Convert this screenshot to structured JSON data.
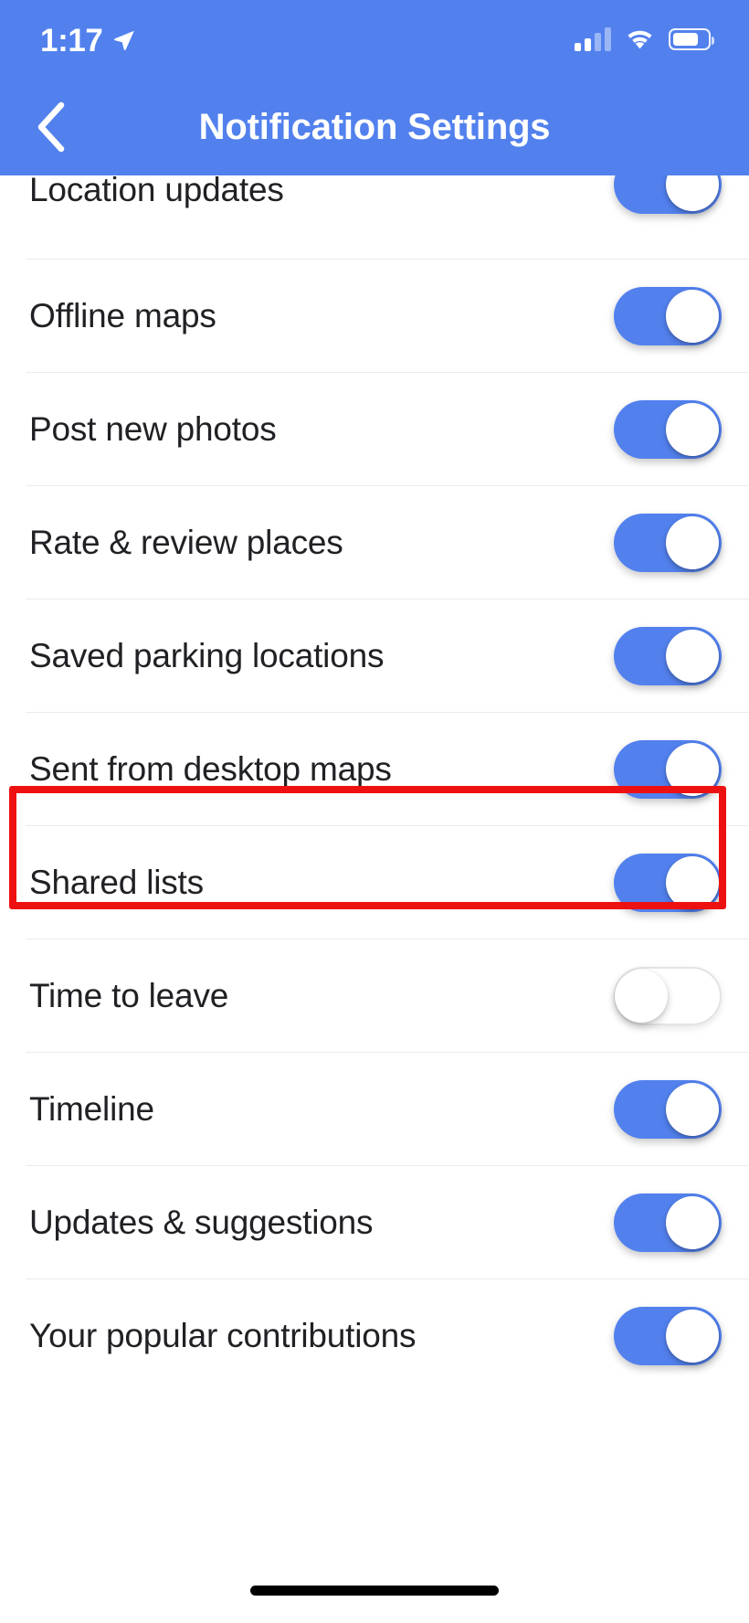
{
  "status_bar": {
    "time": "1:17",
    "location_arrow_icon": "location-arrow-icon",
    "cellular_icon": "cellular-signal-icon",
    "cellular_bars_filled": 2,
    "cellular_bars_total": 4,
    "wifi_icon": "wifi-icon",
    "battery_icon": "battery-icon",
    "battery_level_percent": 66
  },
  "header": {
    "back_icon": "chevron-left-icon",
    "title": "Notification Settings",
    "background_color": "#5281EE",
    "text_color": "#FFFFFF"
  },
  "settings_list": {
    "accent_color": "#5281EE",
    "rows": [
      {
        "label": "Location updates",
        "state": "on",
        "clipped": true
      },
      {
        "label": "Offline maps",
        "state": "on",
        "clipped": false
      },
      {
        "label": "Post new photos",
        "state": "on",
        "clipped": false
      },
      {
        "label": "Rate & review places",
        "state": "on",
        "clipped": false
      },
      {
        "label": "Saved parking locations",
        "state": "on",
        "clipped": false
      },
      {
        "label": "Sent from desktop maps",
        "state": "on",
        "clipped": false
      },
      {
        "label": "Shared lists",
        "state": "on",
        "clipped": false
      },
      {
        "label": "Time to leave",
        "state": "off",
        "clipped": false
      },
      {
        "label": "Timeline",
        "state": "on",
        "clipped": false
      },
      {
        "label": "Updates & suggestions",
        "state": "on",
        "clipped": false
      },
      {
        "label": "Your popular contributions",
        "state": "on",
        "clipped": false
      }
    ]
  },
  "annotation": {
    "type": "highlight-rectangle",
    "color": "#EE1111",
    "target_label": "Sent from desktop maps"
  },
  "home_indicator": {
    "color": "#000000"
  }
}
